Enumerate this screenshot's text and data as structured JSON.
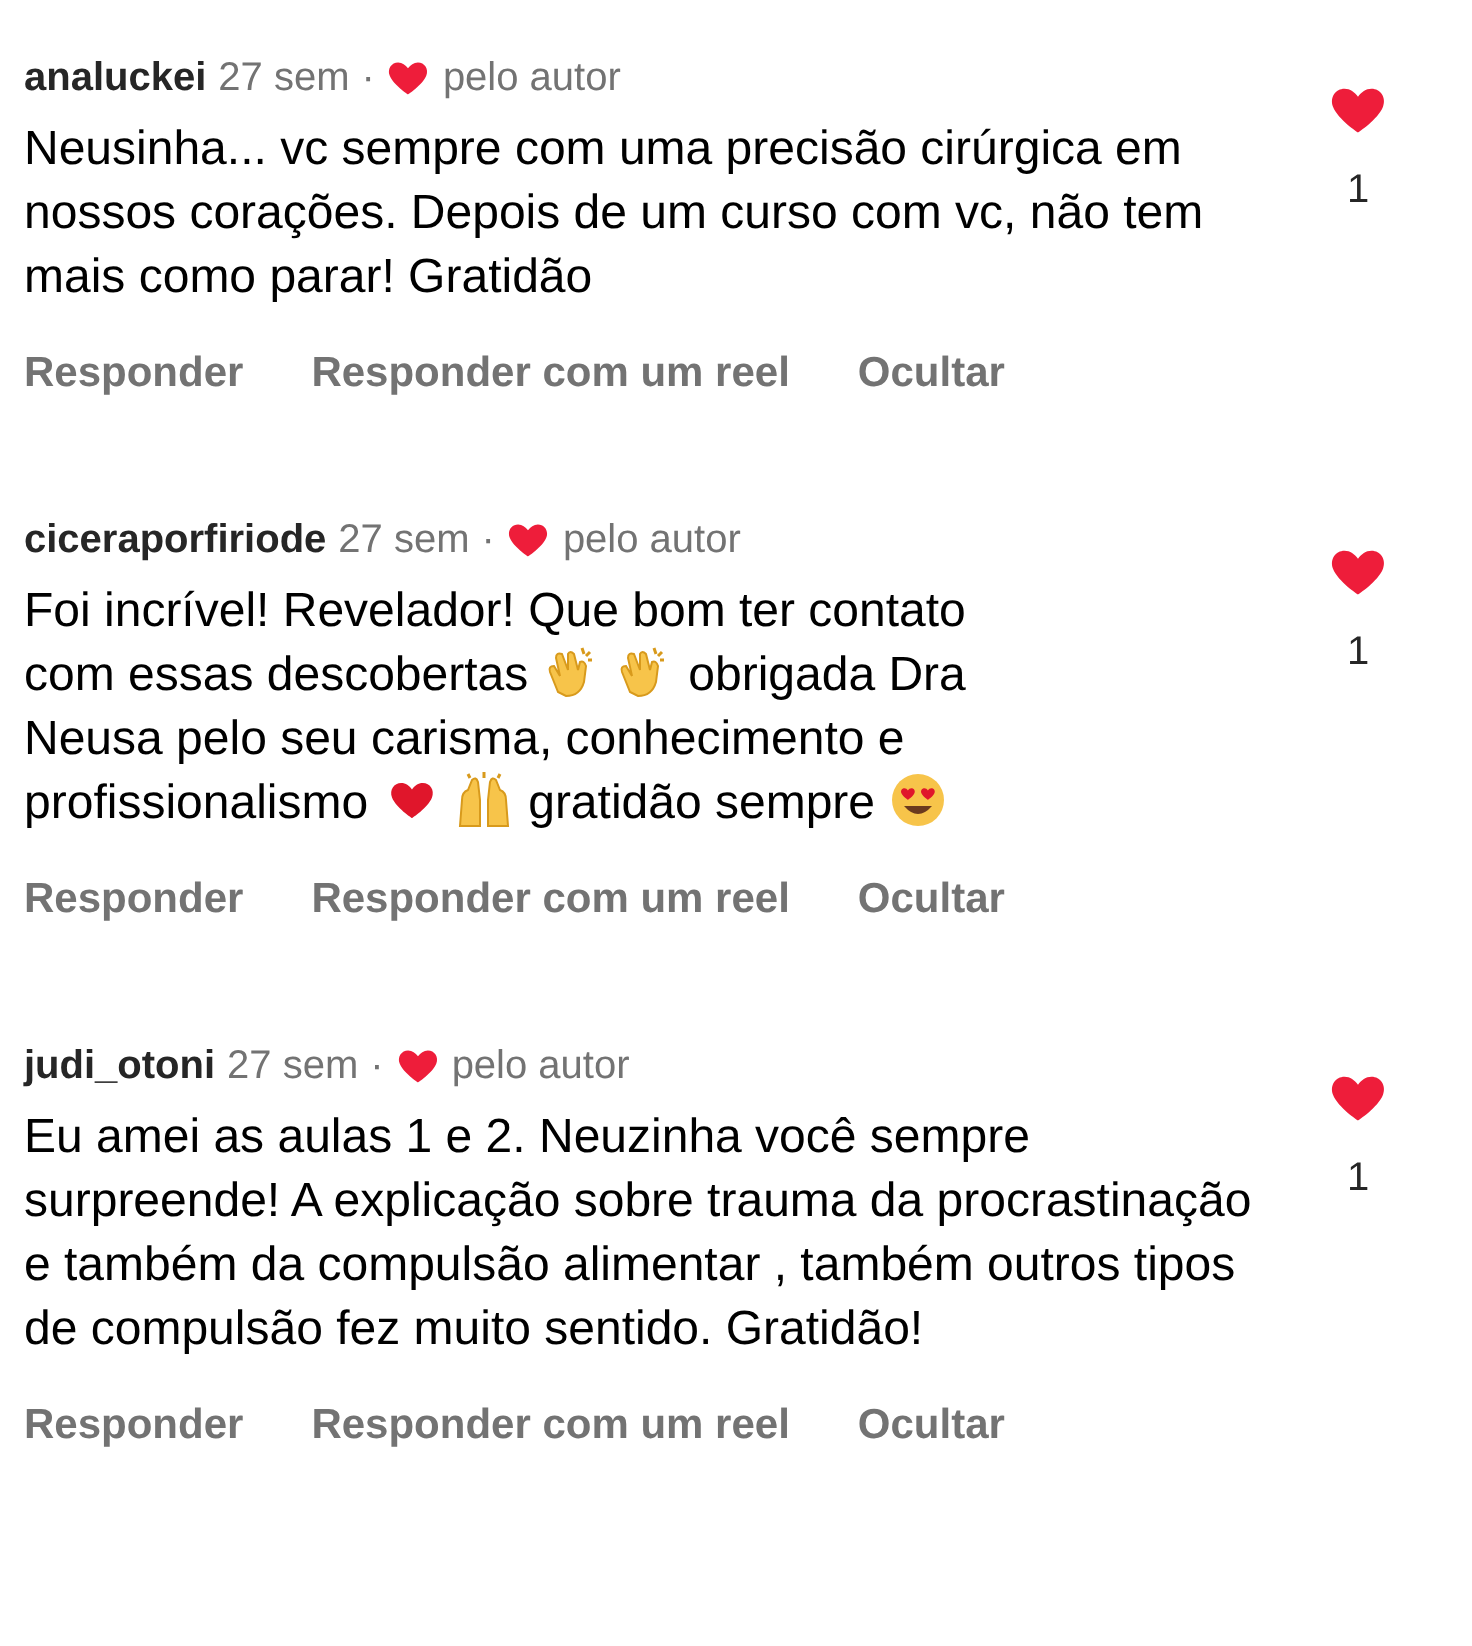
{
  "comments": [
    {
      "username": "analuckei",
      "time": "27 sem",
      "separator": "·",
      "author_like": "pelo autor",
      "segments": [
        {
          "kind": "text",
          "text": "Neusinha... vc sempre com uma precisão cirúrgica em nossos corações.  Depois de um curso com vc, não tem mais como parar! Gratidão"
        }
      ],
      "liked": true,
      "likes": "1",
      "actions": [
        "Responder",
        "Responder com um reel",
        "Ocultar"
      ]
    },
    {
      "username": "ciceraporfiriode",
      "time": "27 sem",
      "separator": "·",
      "author_like": "pelo autor",
      "segments": [
        {
          "kind": "text",
          "text": "Foi incrível! Revelador! Que bom ter contato"
        },
        {
          "kind": "text",
          "text": "com essas descobertas"
        },
        {
          "kind": "clap"
        },
        {
          "kind": "clap"
        },
        {
          "kind": "text",
          "text": "obrigada Dra"
        },
        {
          "kind": "text",
          "text": "Neusa pelo seu carisma, conhecimento e"
        },
        {
          "kind": "text",
          "text": "profissionalismo"
        },
        {
          "kind": "heart"
        },
        {
          "kind": "raised"
        },
        {
          "kind": "text",
          "text": "gratidão sempre"
        },
        {
          "kind": "hearteyes"
        }
      ],
      "liked": true,
      "likes": "1",
      "actions": [
        "Responder",
        "Responder com um reel",
        "Ocultar"
      ]
    },
    {
      "username": "judi_otoni",
      "time": "27 sem",
      "separator": "·",
      "author_like": "pelo autor",
      "segments": [
        {
          "kind": "text",
          "text": "Eu amei as aulas 1 e 2. Neuzinha você sempre surpreende! A explicação sobre trauma da procrastinação e também da compulsão alimentar , também outros tipos de compulsão fez muito sentido. Gratidão!"
        }
      ],
      "liked": true,
      "likes": "1",
      "actions": [
        "Responder",
        "Responder com um reel",
        "Ocultar"
      ]
    }
  ]
}
